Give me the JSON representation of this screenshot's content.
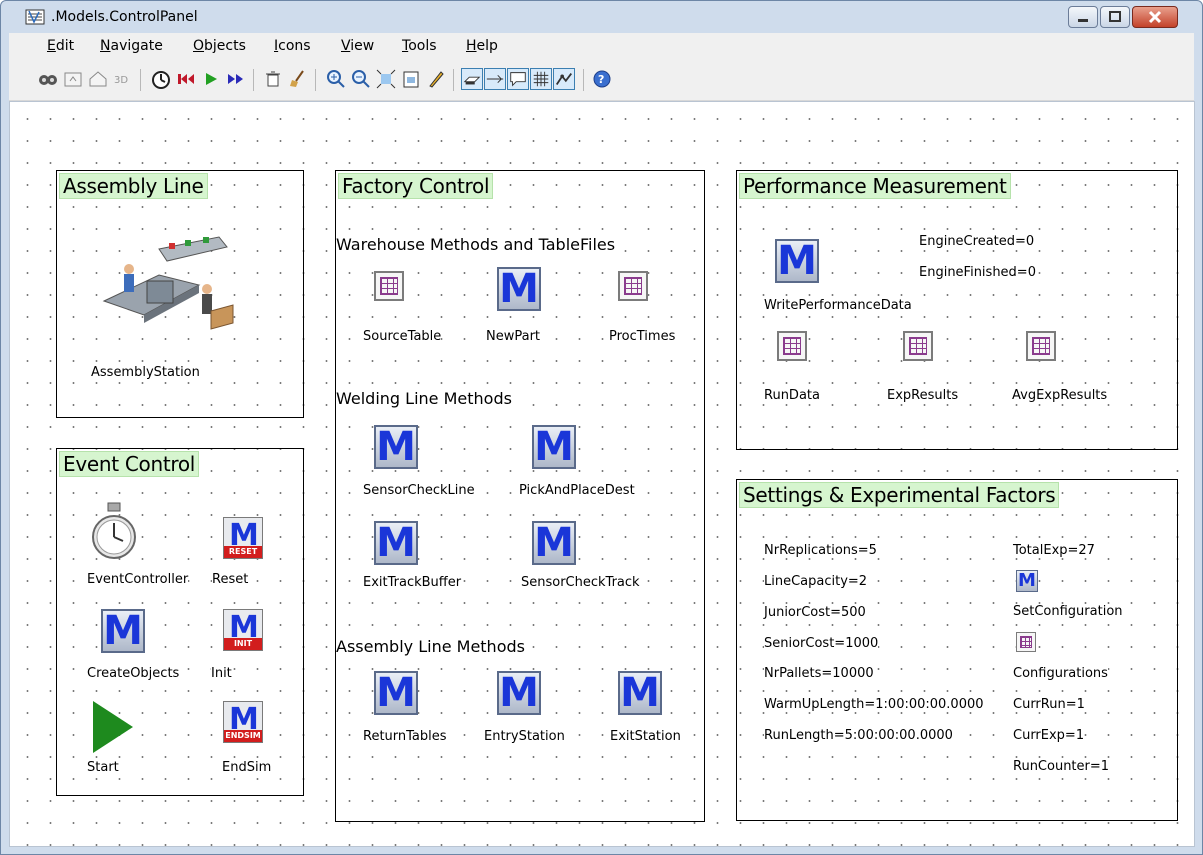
{
  "window": {
    "title": ".Models.ControlPanel"
  },
  "menu": [
    {
      "pre": "",
      "u": "E",
      "post": "dit"
    },
    {
      "pre": "",
      "u": "N",
      "post": "avigate"
    },
    {
      "pre": "",
      "u": "O",
      "post": "bjects"
    },
    {
      "pre": "",
      "u": "I",
      "post": "cons"
    },
    {
      "pre": "",
      "u": "V",
      "post": "iew"
    },
    {
      "pre": "",
      "u": "T",
      "post": "ools"
    },
    {
      "pre": "",
      "u": "H",
      "post": "elp"
    }
  ],
  "toolbar": {
    "icons": [
      "open-origin-icon",
      "go-to-parent-icon",
      "home-icon",
      "3d-icon",
      "event-controller-icon",
      "reset-icon",
      "start-icon",
      "step-icon",
      "delete-icon",
      "cleanup-icon",
      "zoom-in-icon",
      "zoom-out-icon",
      "zoom-fit-icon",
      "screenshot-icon",
      "draw-icon",
      "connector-mode-icon",
      "edge-icon",
      "comments-icon",
      "grid-icon",
      "route-icon",
      "help-icon"
    ]
  },
  "frames": {
    "assembly_line": {
      "title": "Assembly Line",
      "objects": {
        "station": "AssemblyStation"
      }
    },
    "event_control": {
      "title": "Event Control",
      "objects": {
        "event_controller": "EventController",
        "reset": "Reset",
        "reset_tag": "RESET",
        "create_objects": "CreateObjects",
        "init": "Init",
        "init_tag": "INIT",
        "start": "Start",
        "endsim": "EndSim",
        "endsim_tag": "ENDSIM"
      }
    },
    "factory_control": {
      "title": "Factory Control",
      "sections": {
        "warehouse": "Warehouse Methods and TableFiles",
        "welding": "Welding Line Methods",
        "assembly": "Assembly Line Methods"
      },
      "objects": {
        "source_table": "SourceTable",
        "new_part": "NewPart",
        "proc_times": "ProcTimes",
        "sensor_check_line": "SensorCheckLine",
        "pick_and_place_dest": "PickAndPlaceDest",
        "exit_track_buffer": "ExitTrackBuffer",
        "sensor_check_track": "SensorCheckTrack",
        "return_tables": "ReturnTables",
        "entry_station": "EntryStation",
        "exit_station": "ExitStation"
      }
    },
    "performance": {
      "title": "Performance Measurement",
      "objects": {
        "write_perf": "WritePerformanceData",
        "engine_created": "EngineCreated=0",
        "engine_finished": "EngineFinished=0",
        "run_data": "RunData",
        "exp_results": "ExpResults",
        "avg_exp_results": "AvgExpResults"
      }
    },
    "settings": {
      "title": "Settings & Experimental Factors",
      "objects": {
        "nr_replications": "NrReplications=5",
        "line_capacity": "LineCapacity=2",
        "junior_cost": "JuniorCost=500",
        "senior_cost": "SeniorCost=1000",
        "nr_pallets": "NrPallets=10000",
        "warm_up": "WarmUpLength=1:00:00:00.0000",
        "run_length": "RunLength=5:00:00:00.0000",
        "total_exp": "TotalExp=27",
        "set_configuration": "SetConfiguration",
        "configurations": "Configurations",
        "curr_run": "CurrRun=1",
        "curr_exp": "CurrExp=1",
        "run_counter": "RunCounter=1"
      }
    }
  },
  "colors": {
    "frame_title_bg": "#d6f5cf",
    "method_letter": "#1a36d8",
    "special_tag": "#d21d1d",
    "start_triangle": "#1e8a1e"
  }
}
